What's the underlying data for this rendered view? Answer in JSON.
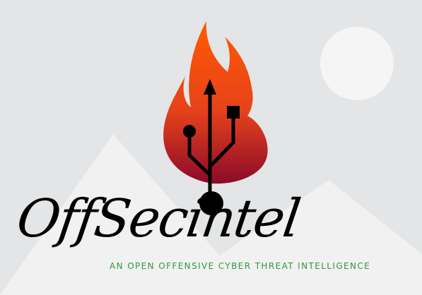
{
  "brand": {
    "name": "OffSecintel",
    "tagline": "AN  OPEN OFFENSIVE CYBER THREAT INTELLIGENCE"
  },
  "icons": {
    "flame": "flame-icon",
    "usb": "usb-icon",
    "placeholder": "image-placeholder-icon"
  },
  "colors": {
    "background": "#e4e5e6",
    "mountains": "#f1f1f1",
    "sun": "#f5f5f5",
    "flame_top": "#ff5a00",
    "flame_bottom": "#8c0a2a",
    "symbol": "#000000",
    "tagline": "#2f9a3a"
  }
}
